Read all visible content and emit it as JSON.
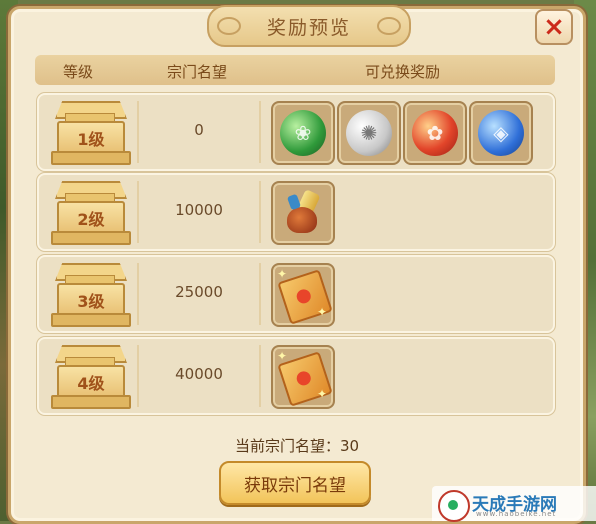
{
  "title": "奖励预览",
  "close_icon": "×",
  "headers": {
    "level": "等级",
    "reputation": "宗门名望",
    "rewards": "可兑换奖励"
  },
  "rows": [
    {
      "level": "1级",
      "reputation": "0",
      "rewards": [
        "green-beast-orb-icon",
        "white-tiger-orb-icon",
        "red-phoenix-orb-icon",
        "blue-turtle-orb-icon"
      ]
    },
    {
      "level": "2级",
      "reputation": "10000",
      "rewards": [
        "item-pouch-icon"
      ]
    },
    {
      "level": "3级",
      "reputation": "25000",
      "rewards": [
        "ticket-icon"
      ]
    },
    {
      "level": "4级",
      "reputation": "40000",
      "rewards": [
        "ticket-icon"
      ]
    }
  ],
  "current": {
    "label": "当前宗门名望：",
    "value": "30"
  },
  "button": {
    "label": "获取宗门名望"
  },
  "watermark": {
    "text": "天成手游网",
    "sub": "www.haobeike.net"
  }
}
